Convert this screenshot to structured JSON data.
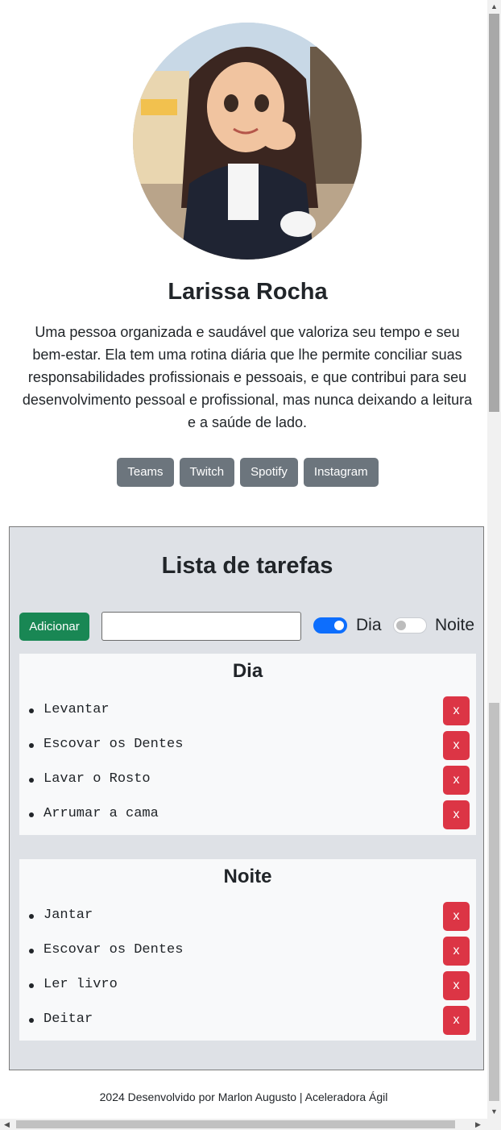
{
  "profile": {
    "name": "Larissa Rocha",
    "bio": "Uma pessoa organizada e saudável que valoriza seu tempo e seu bem-estar. Ela tem uma rotina diária que lhe permite conciliar suas responsabilidades profissionais e pessoais, e que contribui para seu desenvolvimento pessoal e profissional, mas nunca deixando a leitura e a saúde de lado.",
    "socials": [
      "Teams",
      "Twitch",
      "Spotify",
      "Instagram"
    ]
  },
  "tasks": {
    "title": "Lista de tarefas",
    "add_label": "Adicionar",
    "input_value": "",
    "toggle_day": {
      "label": "Dia",
      "checked": true
    },
    "toggle_night": {
      "label": "Noite",
      "checked": false
    },
    "day": {
      "title": "Dia",
      "items": [
        "Levantar",
        "Escovar os Dentes",
        "Lavar o Rosto",
        "Arrumar a cama"
      ]
    },
    "night": {
      "title": "Noite",
      "items": [
        "Jantar",
        "Escovar os Dentes",
        "Ler livro",
        "Deitar"
      ]
    },
    "delete_label": "x"
  },
  "footer": {
    "text": "2024 Desenvolvido por Marlon Augusto | Aceleradora Ágil"
  },
  "colors": {
    "social_button": "#6c757d",
    "add_button": "#198754",
    "delete_button": "#dc3545",
    "toggle_on": "#0d6efd",
    "task_section_bg": "#dee1e6"
  }
}
